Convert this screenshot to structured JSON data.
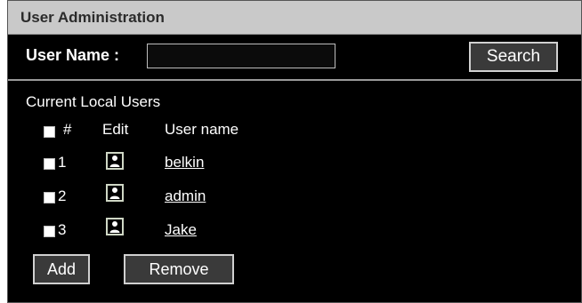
{
  "window": {
    "title": "User Administration"
  },
  "search": {
    "label": "User Name :",
    "value": "",
    "placeholder": "",
    "button_label": "Search"
  },
  "users_section": {
    "title": "Current Local Users",
    "headers": {
      "number": "#",
      "edit": "Edit",
      "username": "User name"
    },
    "rows": [
      {
        "number": "1",
        "username": "belkin",
        "edit_icon": "user-edit-icon"
      },
      {
        "number": "2",
        "username": "admin",
        "edit_icon": "user-edit-icon"
      },
      {
        "number": "3",
        "username": "Jake",
        "edit_icon": "user-edit-icon"
      }
    ]
  },
  "actions": {
    "add_label": "Add",
    "remove_label": "Remove"
  }
}
